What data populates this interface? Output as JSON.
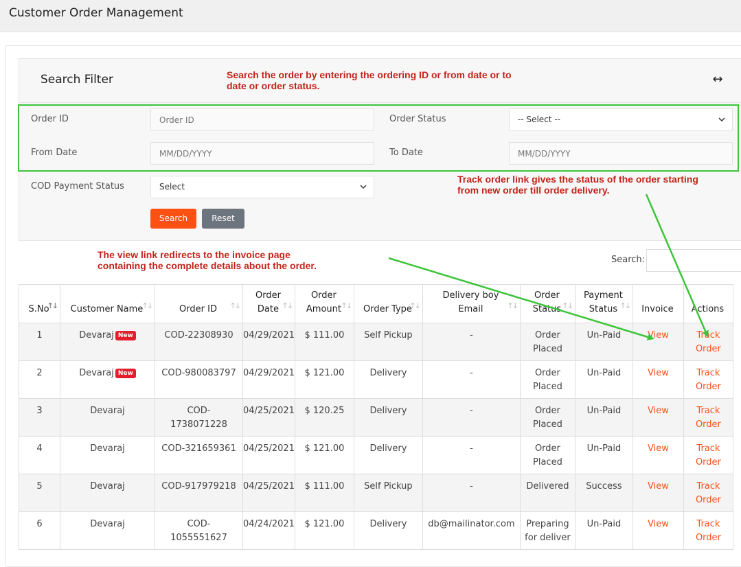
{
  "header": {
    "title": "Customer Order Management"
  },
  "filter": {
    "title": "Search Filter",
    "order_id_label": "Order ID",
    "order_id_placeholder": "Order ID",
    "order_status_label": "Order Status",
    "order_status_value": "-- Select --",
    "from_date_label": "From Date",
    "from_date_placeholder": "MM/DD/YYYY",
    "to_date_label": "To Date",
    "to_date_placeholder": "MM/DD/YYYY",
    "cod_label": "COD Payment Status",
    "cod_value": "Select",
    "search_button": "Search",
    "reset_button": "Reset"
  },
  "annotations": {
    "filter_note_1": "Search the order by entering the ordering ID or from date or to",
    "filter_note_2": "date or order status.",
    "track_note_1": "Track order link gives the status of the order starting",
    "track_note_2": "from new order till order delivery.",
    "view_note_1": "The view link redirects to the invoice page",
    "view_note_2": "containing the complete details about the order."
  },
  "table_search_label": "Search:",
  "table": {
    "columns": [
      [
        "S.No"
      ],
      [
        "Customer Name"
      ],
      [
        "Order ID"
      ],
      [
        "Order",
        "Date"
      ],
      [
        "Order",
        "Amount"
      ],
      [
        "Order Type"
      ],
      [
        "Delivery boy",
        "Email"
      ],
      [
        "Order",
        "Status"
      ],
      [
        "Payment",
        "Status"
      ],
      [
        "Invoice"
      ],
      [
        "Actions"
      ]
    ],
    "new_badge": "New",
    "rows": [
      {
        "sno": "1",
        "name": "Devaraj",
        "is_new": true,
        "order_id": "COD-22308930",
        "date": "04/29/2021",
        "amount": "$ 111.00",
        "type": "Self Pickup",
        "email": "-",
        "status": "Order Placed",
        "payment": "Un-Paid",
        "invoice": "View",
        "action": "Track Order"
      },
      {
        "sno": "2",
        "name": "Devaraj",
        "is_new": true,
        "order_id": "COD-980083797",
        "date": "04/29/2021",
        "amount": "$ 121.00",
        "type": "Delivery",
        "email": "-",
        "status": "Order Placed",
        "payment": "Un-Paid",
        "invoice": "View",
        "action": "Track Order"
      },
      {
        "sno": "3",
        "name": "Devaraj",
        "is_new": false,
        "order_id": "COD-1738071228",
        "date": "04/25/2021",
        "amount": "$ 120.25",
        "type": "Delivery",
        "email": "-",
        "status": "Order Placed",
        "payment": "Un-Paid",
        "invoice": "View",
        "action": "Track Order"
      },
      {
        "sno": "4",
        "name": "Devaraj",
        "is_new": false,
        "order_id": "COD-321659361",
        "date": "04/25/2021",
        "amount": "$ 121.00",
        "type": "Delivery",
        "email": "-",
        "status": "Order Placed",
        "payment": "Un-Paid",
        "invoice": "View",
        "action": "Track Order"
      },
      {
        "sno": "5",
        "name": "Devaraj",
        "is_new": false,
        "order_id": "COD-917979218",
        "date": "04/25/2021",
        "amount": "$ 111.00",
        "type": "Self Pickup",
        "email": "-",
        "status": "Delivered",
        "payment": "Success",
        "invoice": "View",
        "action": "Track Order"
      },
      {
        "sno": "6",
        "name": "Devaraj",
        "is_new": false,
        "order_id": "COD-1055551627",
        "date": "04/24/2021",
        "amount": "$ 121.00",
        "type": "Delivery",
        "email": "db@mailinator.com",
        "status": "Preparing for deliver",
        "payment": "Un-Paid",
        "invoice": "View",
        "action": "Track Order"
      }
    ]
  },
  "colors": {
    "accent": "#fd5013",
    "annotation": "#c4231a",
    "highlight": "#3cc43a",
    "badge": "#e41e2c"
  }
}
